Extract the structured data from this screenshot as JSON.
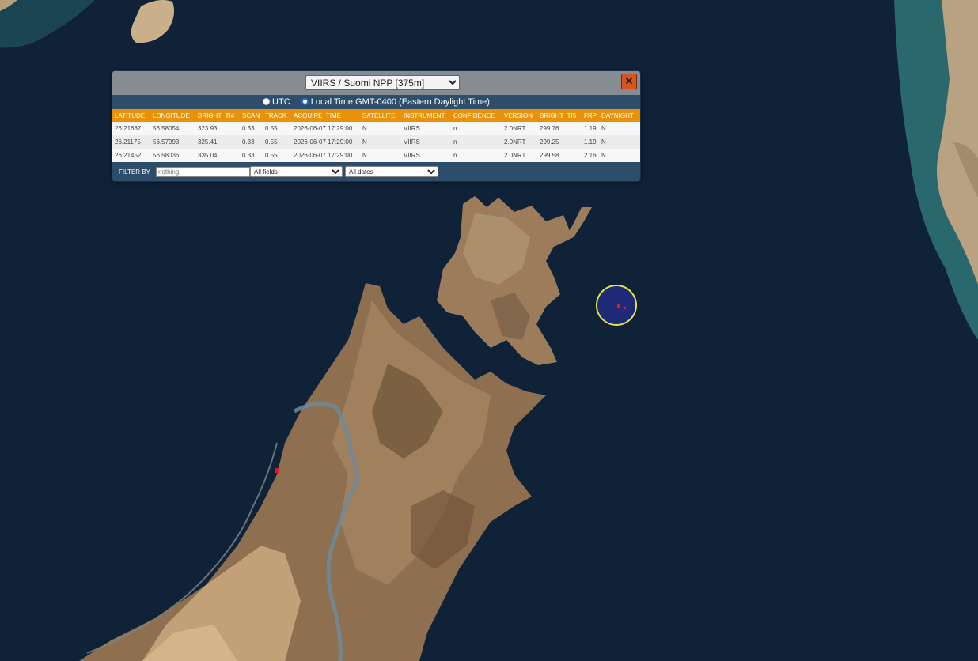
{
  "panel": {
    "dataset_select": "VIIRS / Suomi NPP [375m]",
    "close_label": "✕",
    "time_options": {
      "utc_label": "UTC",
      "local_label": "Local Time GMT-0400 (Eastern Daylight Time)",
      "selected": "local"
    }
  },
  "table": {
    "columns": [
      "LATITUDE",
      "LONGITUDE",
      "BRIGHT_TI4",
      "SCAN",
      "TRACK",
      "ACQUIRE_TIME",
      "SATELLITE",
      "INSTRUMENT",
      "CONFIDENCE",
      "VERSION",
      "BRIGHT_TI5",
      "FRP",
      "DAYNIGHT"
    ],
    "rows": [
      [
        "26.21687",
        "56.58054",
        "323.93",
        "0.33",
        "0.55",
        "2026-06-07 17:29:00",
        "N",
        "VIIRS",
        "n",
        "2.0NRT",
        "299.76",
        "1.19",
        "N"
      ],
      [
        "26.21175",
        "56.57993",
        "325.41",
        "0.33",
        "0.55",
        "2026-06-07 17:29:00",
        "N",
        "VIIRS",
        "n",
        "2.0NRT",
        "299.25",
        "1.19",
        "N"
      ],
      [
        "26.21452",
        "56.58036",
        "335.04",
        "0.33",
        "0.55",
        "2026-06-07 17:29:00",
        "N",
        "VIIRS",
        "n",
        "2.0NRT",
        "299.58",
        "2.16",
        "N"
      ]
    ]
  },
  "filter": {
    "label": "FILTER BY",
    "placeholder": "nothing",
    "fields_select": "All fields",
    "dates_select": "All dates"
  },
  "colors": {
    "sea": "#0f2238",
    "header_accent": "#e8920c",
    "panel": "#2d4d6a",
    "close": "#d9541e",
    "highlight_ring": "#e9e33a",
    "fire_marker": "#e0182a"
  }
}
